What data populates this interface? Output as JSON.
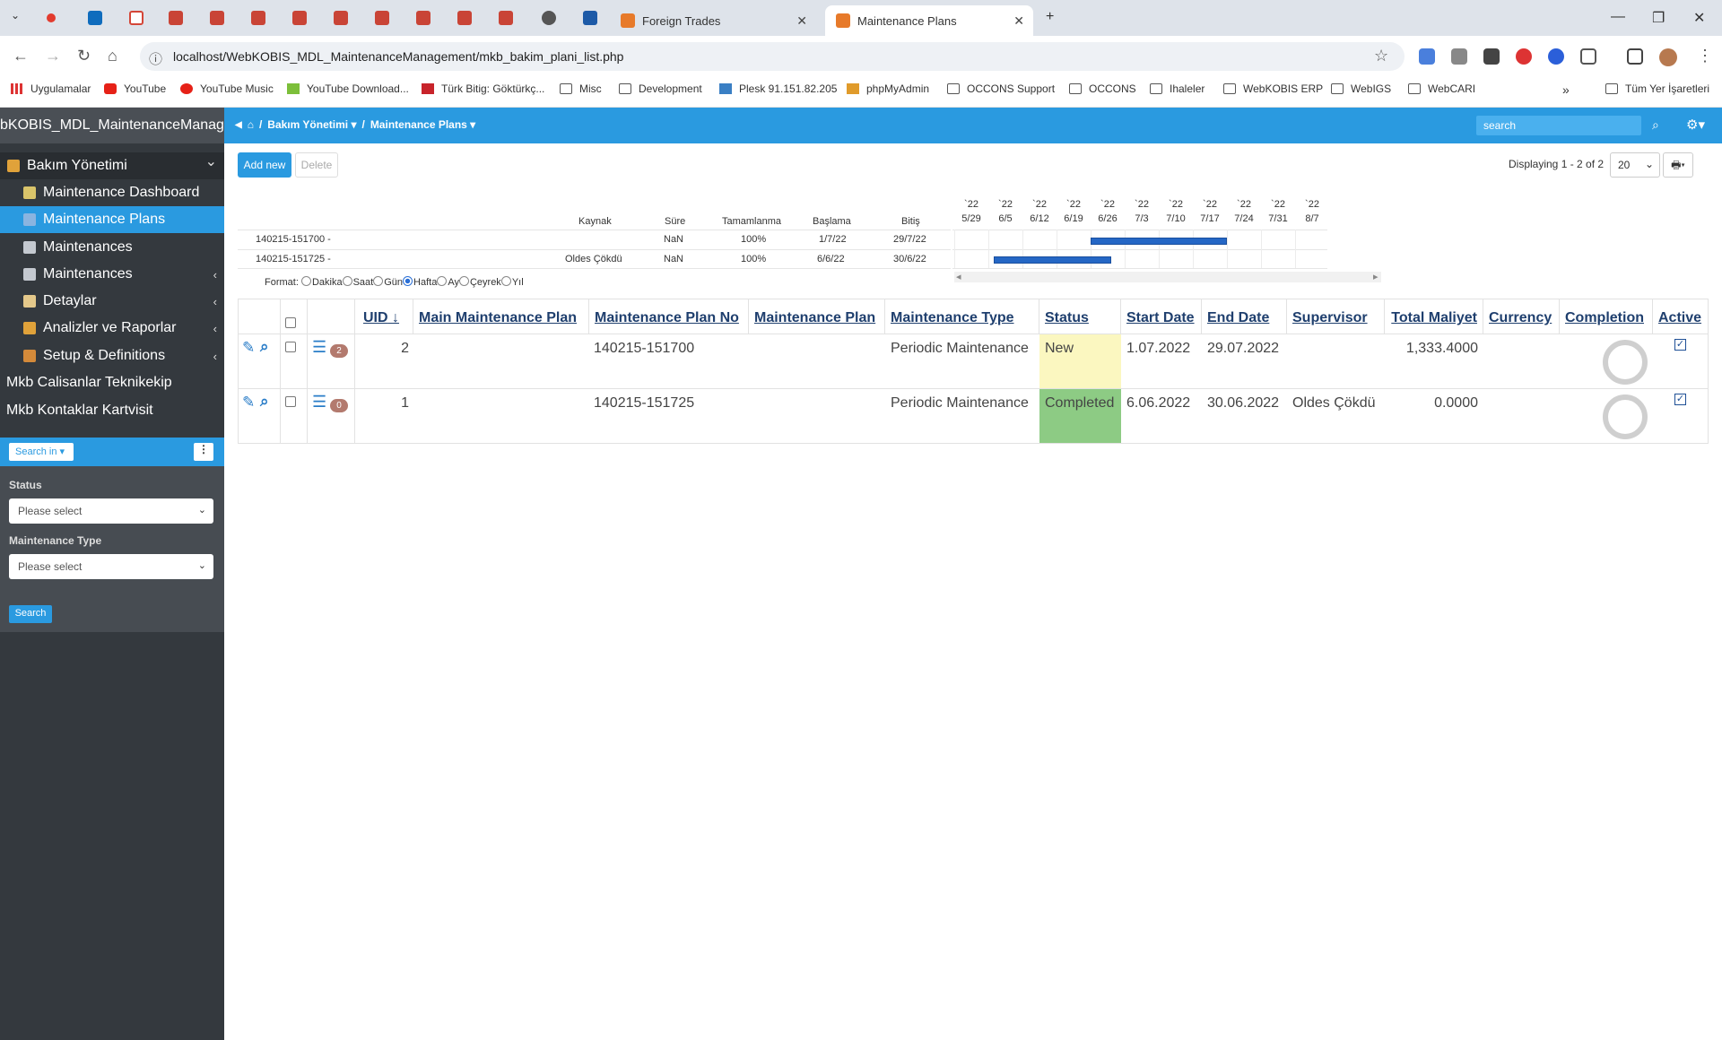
{
  "browser": {
    "tabs": [
      {
        "title": "Foreign Trades"
      },
      {
        "title": "Maintenance Plans"
      }
    ],
    "url": "localhost/WebKOBIS_MDL_MaintenanceManagement/mkb_bakim_plani_list.php",
    "bookmarks": [
      "Uygulamalar",
      "YouTube",
      "YouTube Music",
      "YouTube Download...",
      "Türk Bitig: Göktürkç...",
      "Misc",
      "Development",
      "Plesk 91.151.82.205",
      "phpMyAdmin",
      "OCCONS Support",
      "OCCONS",
      "Ihaleler",
      "WebKOBIS ERP",
      "WebIGS",
      "WebCARI",
      "Tüm Yer İşaretleri"
    ],
    "more": "»",
    "close_glyph": "✕",
    "new_tab": "+",
    "window_controls": {
      "minimize": "—",
      "restore": "❐",
      "close": "✕"
    },
    "nav": {
      "back": "←",
      "forward": "→",
      "reload": "↻",
      "home": "⌂",
      "info": "ⓘ",
      "star": "☆",
      "menu": "⋮"
    }
  },
  "app": {
    "name": "bKOBIS_MDL_MaintenanceManagem",
    "breadcrumb": {
      "home": "⌂",
      "sep": "/",
      "section": "Bakım Yönetimi ▾",
      "current": "Maintenance Plans ▾"
    },
    "search_placeholder": "search",
    "search_glyph": "⌕",
    "gear_glyph": "⚙▾"
  },
  "sidebar": {
    "header": "Bakım Yönetimi",
    "items": [
      {
        "label": "Maintenance Dashboard",
        "color": "#d9c46a"
      },
      {
        "label": "Maintenance Plans",
        "color": "#8ab4e0"
      },
      {
        "label": "Maintenances",
        "color": "#c4c9d0"
      },
      {
        "label": "Maintenances",
        "color": "#c4c9d0"
      },
      {
        "label": "Detaylar",
        "color": "#e4c88a"
      },
      {
        "label": "Analizler ve Raporlar",
        "color": "#e0a23a"
      },
      {
        "label": "Setup & Definitions",
        "color": "#d48a3a"
      }
    ],
    "plain_items": [
      "Mkb Calisanlar Teknikekip",
      "Mkb Kontaklar Kartvisit"
    ],
    "chevron": "‹",
    "header_chevron": "⌄",
    "search_in": "Search in ▾",
    "dots": "⋮",
    "filters": [
      {
        "label": "Status",
        "placeholder": "Please select"
      },
      {
        "label": "Maintenance Type",
        "placeholder": "Please select"
      }
    ],
    "dropdown_glyph": "⌄",
    "search_button": "Search"
  },
  "toolbar": {
    "add_new": "Add new",
    "delete": "Delete",
    "displaying": "Displaying 1 - 2 of 2",
    "page_size": "20",
    "page_size_glyph": "⌄",
    "print": "🖶▾"
  },
  "gantt": {
    "headers": [
      "Kaynak",
      "Süre",
      "Tamamlanma",
      "Başlama",
      "Bitiş"
    ],
    "rows": [
      {
        "name": "140215-151700 -",
        "kaynak": "",
        "sure": "NaN",
        "tam": "100%",
        "bas": "1/7/22",
        "bit": "29/7/22",
        "bar_start": 4.0,
        "bar_end": 8.0
      },
      {
        "name": "140215-151725 -",
        "kaynak": "Oldes Çökdü",
        "sure": "NaN",
        "tam": "100%",
        "bas": "6/6/22",
        "bit": "30/6/22",
        "bar_start": 1.15,
        "bar_end": 4.6
      }
    ],
    "weeks": [
      {
        "yr": "`22",
        "d": "5/29"
      },
      {
        "yr": "`22",
        "d": "6/5"
      },
      {
        "yr": "`22",
        "d": "6/12"
      },
      {
        "yr": "`22",
        "d": "6/19"
      },
      {
        "yr": "`22",
        "d": "6/26"
      },
      {
        "yr": "`22",
        "d": "7/3"
      },
      {
        "yr": "`22",
        "d": "7/10"
      },
      {
        "yr": "`22",
        "d": "7/17"
      },
      {
        "yr": "`22",
        "d": "7/24"
      },
      {
        "yr": "`22",
        "d": "7/31"
      },
      {
        "yr": "`22",
        "d": "8/7"
      }
    ],
    "format_label": "Format:",
    "formats": [
      "Dakika",
      "Saat",
      "Gün",
      "Hafta",
      "Ay",
      "Çeyrek",
      "Yıl"
    ],
    "selected_format": "Hafta",
    "scroll_left": "◂",
    "scroll_right": "▸"
  },
  "table": {
    "columns": [
      "UID",
      "Main Maintenance Plan",
      "Maintenance Plan No",
      "Maintenance Plan",
      "Maintenance Type",
      "Status",
      "Start Date",
      "End Date",
      "Supervisor",
      "Total Maliyet",
      "Currency",
      "Completion",
      "Active"
    ],
    "sort_glyph": "↓",
    "icons": {
      "edit": "✎",
      "view": "⌕",
      "details": "☰"
    },
    "check_glyph": "✓",
    "rows": [
      {
        "uid": "2",
        "main": "",
        "no": "140215-151700",
        "plan": "",
        "type": "Periodic Maintenance",
        "status": "New",
        "status_color": "#fbf7c0",
        "start": "1.07.2022",
        "end": "29.07.2022",
        "supervisor": "",
        "total": "1,333.4000",
        "currency": "",
        "details_count": "2"
      },
      {
        "uid": "1",
        "main": "",
        "no": "140215-151725",
        "plan": "",
        "type": "Periodic Maintenance",
        "status": "Completed",
        "status_color": "#8dcb84",
        "start": "6.06.2022",
        "end": "30.06.2022",
        "supervisor": "Oldes Çökdü",
        "total": "0.0000",
        "currency": "",
        "details_count": "0"
      }
    ]
  }
}
